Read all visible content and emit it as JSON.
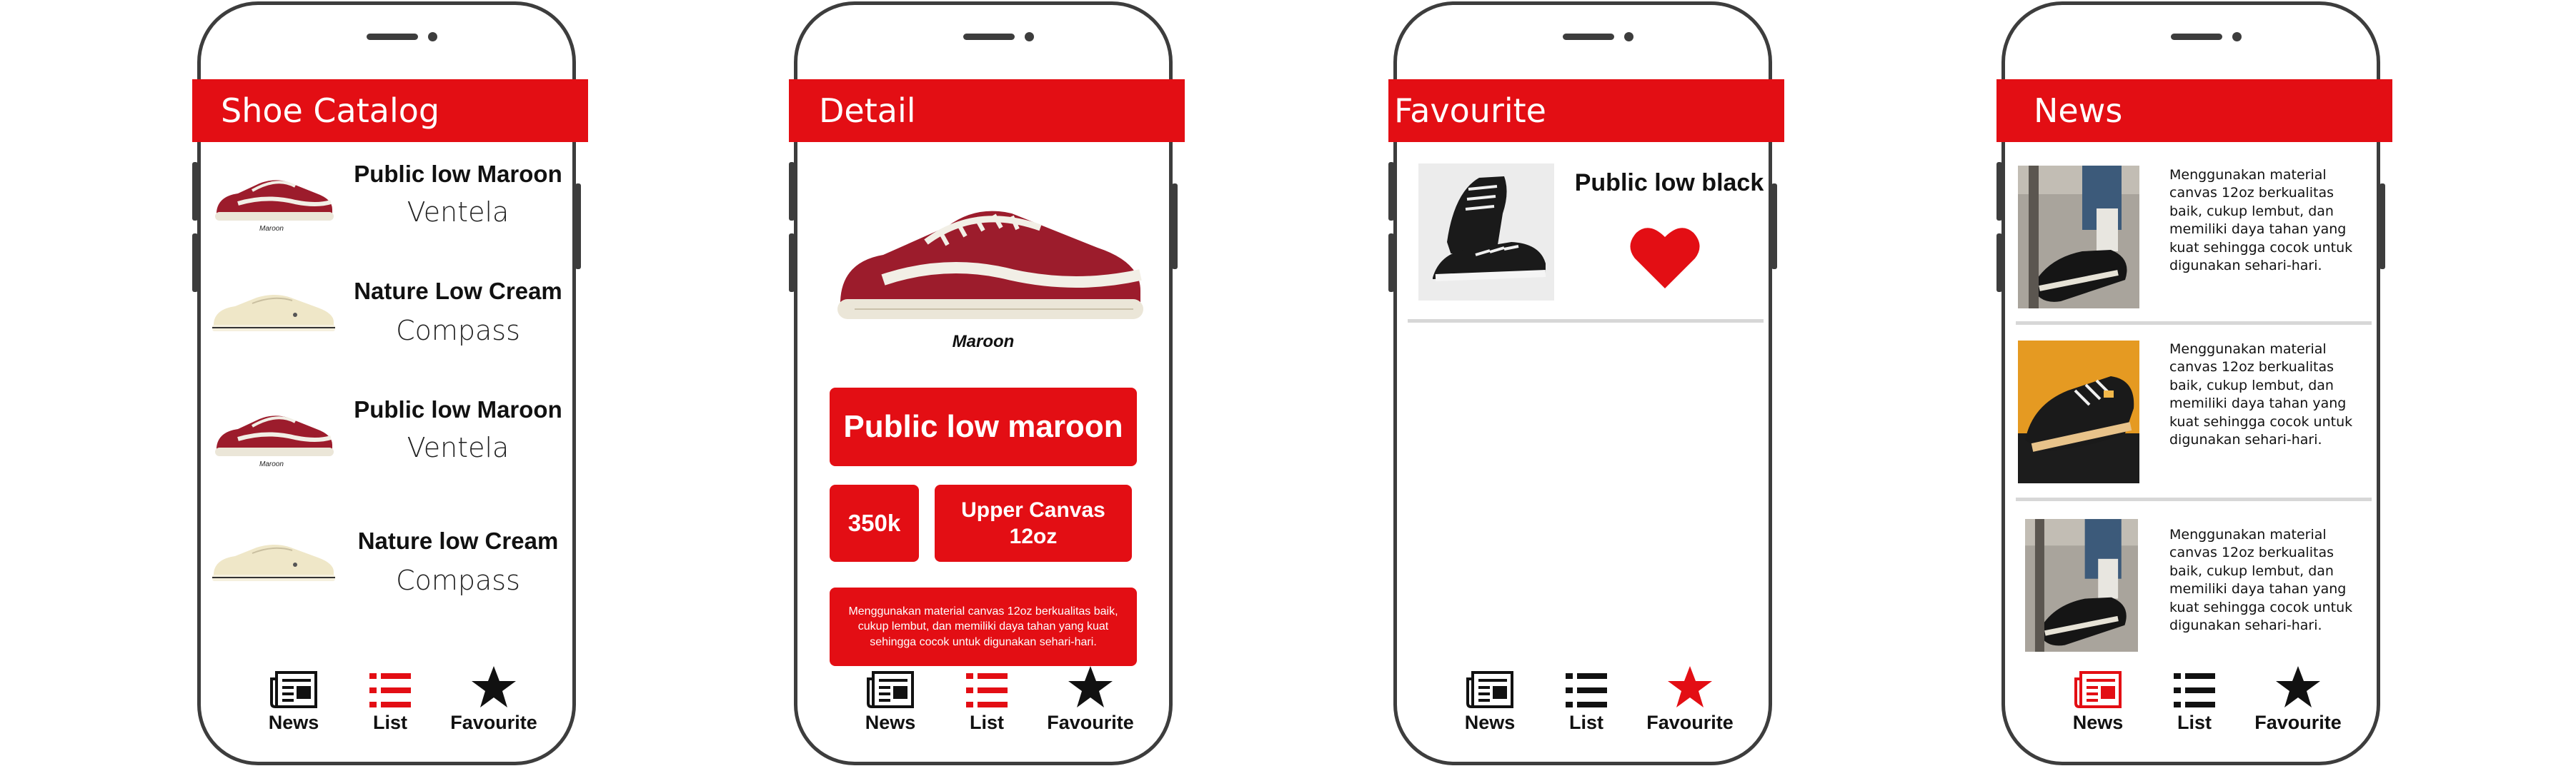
{
  "screens": {
    "catalog": {
      "title": "Shoe Catalog",
      "items": [
        {
          "name": "Public low Maroon",
          "brand": "Ventela",
          "caption": "Maroon",
          "color": "#9c1c2c"
        },
        {
          "name": "Nature Low Cream",
          "brand": "Compass",
          "caption": "",
          "color": "#efe7c8"
        },
        {
          "name": "Public low Maroon",
          "brand": "Ventela",
          "caption": "Maroon",
          "color": "#9c1c2c"
        },
        {
          "name": "Nature low Cream",
          "brand": "Compass",
          "caption": "",
          "color": "#efe7c8"
        }
      ]
    },
    "detail": {
      "title": "Detail",
      "image_caption": "Maroon",
      "product_name": "Public low maroon",
      "price": "350k",
      "material": "Upper Canvas 12oz",
      "description": "Menggunakan material canvas 12oz berkualitas baik, cukup lembut, dan memiliki daya tahan yang kuat sehingga cocok untuk digunakan sehari-hari."
    },
    "favourite": {
      "title": "Favourite",
      "items": [
        {
          "name": "Public low black",
          "favourited": true
        }
      ]
    },
    "news": {
      "title": "News",
      "items": [
        {
          "text": "Menggunakan material canvas 12oz berkualitas baik, cukup lembut, dan memiliki daya tahan yang kuat sehingga cocok untuk digunakan sehari-hari."
        },
        {
          "text": "Menggunakan material canvas 12oz berkualitas baik, cukup lembut, dan memiliki daya tahan yang kuat sehingga cocok untuk digunakan sehari-hari."
        },
        {
          "text": "Menggunakan material canvas 12oz berkualitas baik, cukup lembut, dan memiliki daya tahan yang kuat sehingga cocok untuk digunakan sehari-hari."
        }
      ]
    }
  },
  "nav": {
    "news": "News",
    "list": "List",
    "favourite": "Favourite",
    "icons": {
      "news": "newspaper-icon",
      "list": "list-icon",
      "favourite": "star-icon"
    }
  },
  "colors": {
    "accent": "#e30e14",
    "active_nav": "#e30e14",
    "inactive_nav": "#111111",
    "phone_frame": "#3d3d3d"
  },
  "active_nav": {
    "catalog": "list",
    "detail": "list",
    "favourite": "favourite",
    "news": "news"
  }
}
